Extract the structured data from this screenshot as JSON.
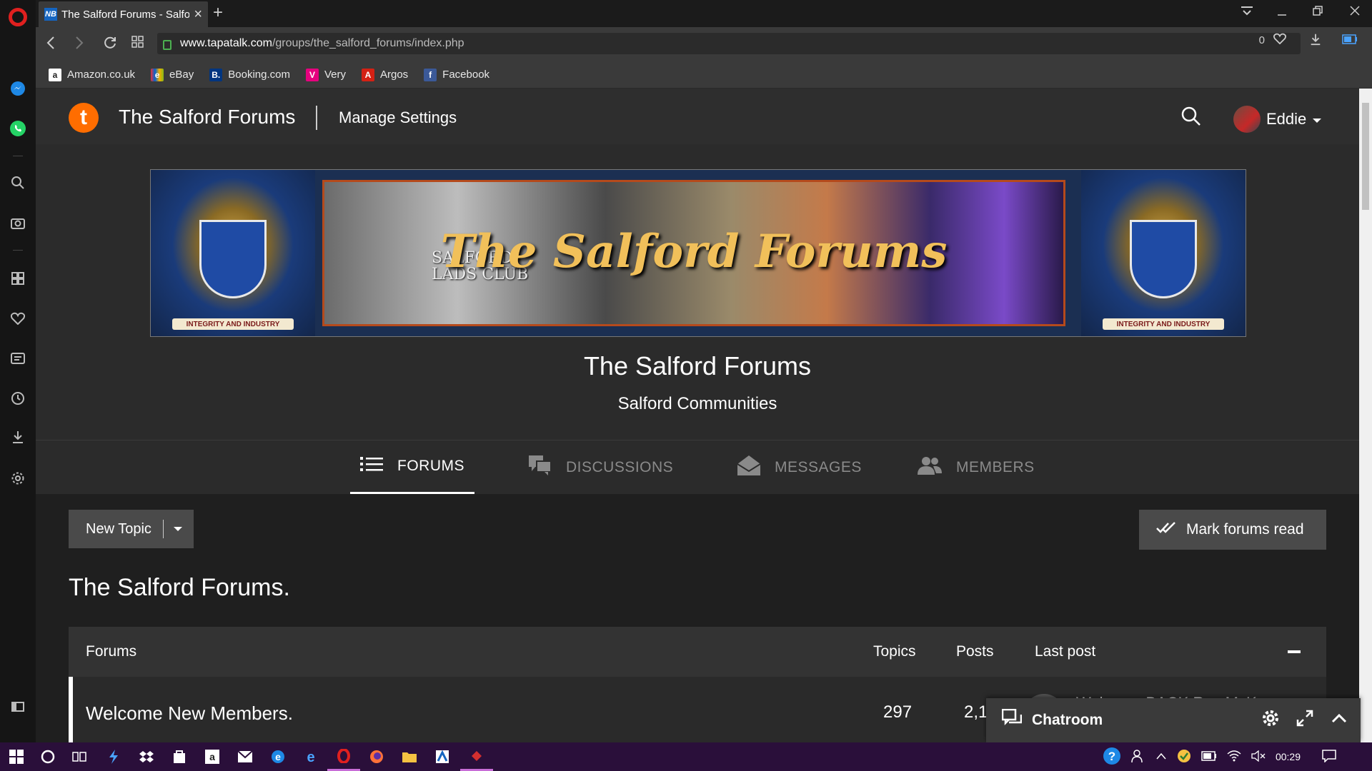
{
  "browser": {
    "tab_title": "The Salford Forums - Salfo",
    "favicon_text": "NB",
    "url_host": "www.tapatalk.com",
    "url_path": "/groups/the_salford_forums/index.php",
    "badge_count": "0",
    "bookmarks": [
      {
        "label": "Amazon.co.uk",
        "icon_text": "a",
        "color": "#222222"
      },
      {
        "label": "eBay",
        "icon_text": "e",
        "color": "#e53238"
      },
      {
        "label": "Booking.com",
        "icon_text": "B.",
        "color": "#003580"
      },
      {
        "label": "Very",
        "icon_text": "V",
        "color": "#e6007e"
      },
      {
        "label": "Argos",
        "icon_text": "A",
        "color": "#d42114"
      },
      {
        "label": "Facebook",
        "icon_text": "f",
        "color": "#3b5998"
      }
    ]
  },
  "site": {
    "logo_letter": "t",
    "name": "The Salford Forums",
    "manage_settings": "Manage Settings",
    "username": "Eddie",
    "banner_title": "The Salford Forums",
    "banner_lads": "SALFORD",
    "banner_lads2": "LADS CLUB",
    "crest_motto": "INTEGRITY AND INDUSTRY",
    "title": "The Salford Forums",
    "subtitle": "Salford Communities"
  },
  "tabs": [
    {
      "label": "FORUMS",
      "icon": "list-icon",
      "active": true
    },
    {
      "label": "DISCUSSIONS",
      "icon": "discussions-icon",
      "active": false
    },
    {
      "label": "MESSAGES",
      "icon": "envelope-icon",
      "active": false
    },
    {
      "label": "MEMBERS",
      "icon": "members-icon",
      "active": false
    }
  ],
  "actions": {
    "new_topic": "New Topic",
    "mark_read": "Mark forums read"
  },
  "section_title": "The Salford Forums.",
  "table": {
    "headers": {
      "forums": "Forums",
      "topics": "Topics",
      "posts": "Posts",
      "last_post": "Last post"
    },
    "rows": [
      {
        "name": "Welcome New Members.",
        "topics": "297",
        "posts": "2,1",
        "last_post": "Welcome BACK Ray McKay"
      }
    ]
  },
  "chatroom": {
    "label": "Chatroom"
  },
  "taskbar": {
    "time": "00:29"
  },
  "colors": {
    "accent": "#ff6d00",
    "opera_red": "#e0201f",
    "taskbar": "#2a0f3a"
  }
}
